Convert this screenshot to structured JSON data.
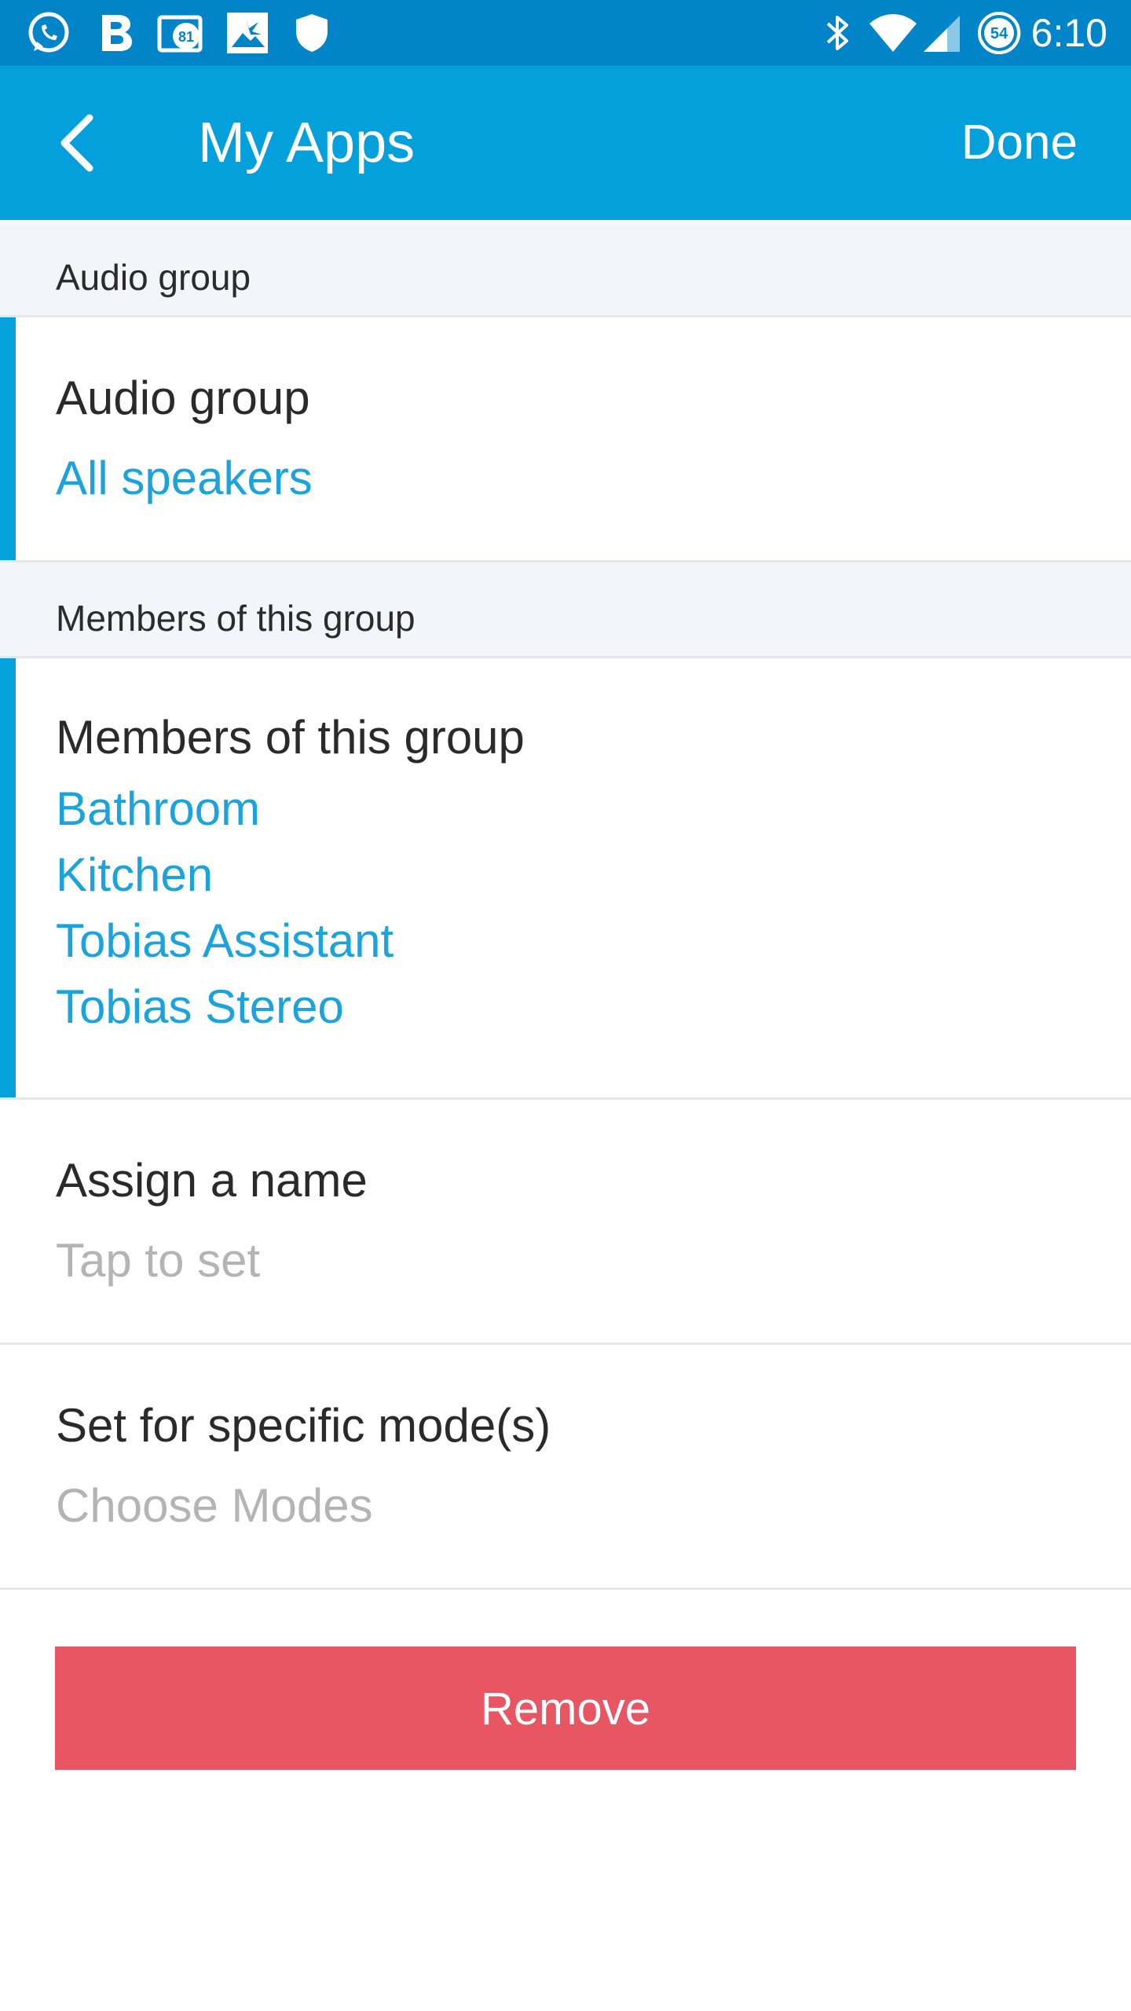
{
  "status_bar": {
    "time": "6:10",
    "icons": {
      "whatsapp": "whatsapp-icon",
      "bold_b": "b-app-icon",
      "mail_badge": "81",
      "photo": "photo-icon",
      "shield": "shield-icon",
      "bluetooth": "bluetooth-icon",
      "wifi": "wifi-icon",
      "signal": "signal-icon",
      "battery": "54"
    }
  },
  "app_bar": {
    "title": "My Apps",
    "done_label": "Done",
    "back_icon": "chevron-left-icon"
  },
  "sections": {
    "audio_group": {
      "header": "Audio group",
      "title": "Audio group",
      "value": "All speakers"
    },
    "members": {
      "header": "Members of this group",
      "title": "Members of this group",
      "items": [
        "Bathroom",
        "Kitchen",
        "Tobias Assistant",
        "Tobias Stereo"
      ]
    },
    "assign_name": {
      "title": "Assign a name",
      "placeholder": "Tap to set"
    },
    "modes": {
      "title": "Set for specific mode(s)",
      "placeholder": "Choose Modes"
    }
  },
  "remove_label": "Remove",
  "colors": {
    "status_bar": "#0285c8",
    "app_bar": "#03a0dc",
    "accent": "#05a2dc",
    "link": "#1aa3dc",
    "remove": "#e85563",
    "section_bg": "#f2f5fa"
  }
}
